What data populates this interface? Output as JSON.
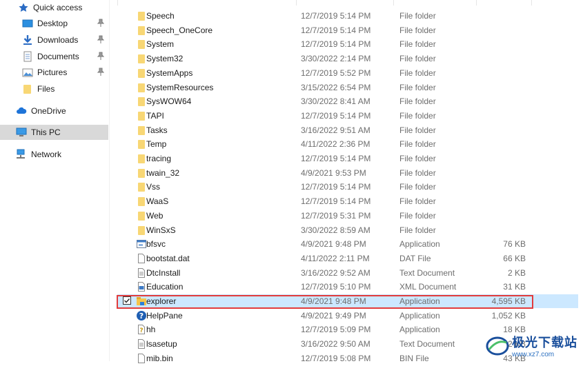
{
  "nav": {
    "quick_access": "Quick access",
    "items": [
      {
        "label": "Desktop",
        "icon": "desktop-icon",
        "pinned": true
      },
      {
        "label": "Downloads",
        "icon": "download-arrow-icon",
        "pinned": true
      },
      {
        "label": "Documents",
        "icon": "documents-icon",
        "pinned": true
      },
      {
        "label": "Pictures",
        "icon": "pictures-icon",
        "pinned": true
      },
      {
        "label": "Files",
        "icon": "folder-icon",
        "pinned": false
      }
    ],
    "onedrive": "OneDrive",
    "this_pc": "This PC",
    "network": "Network"
  },
  "files": [
    {
      "name": "Speech",
      "date": "12/7/2019 5:14 PM",
      "type": "File folder",
      "size": "",
      "icon": "folder-icon"
    },
    {
      "name": "Speech_OneCore",
      "date": "12/7/2019 5:14 PM",
      "type": "File folder",
      "size": "",
      "icon": "folder-icon"
    },
    {
      "name": "System",
      "date": "12/7/2019 5:14 PM",
      "type": "File folder",
      "size": "",
      "icon": "folder-icon"
    },
    {
      "name": "System32",
      "date": "3/30/2022 2:14 PM",
      "type": "File folder",
      "size": "",
      "icon": "folder-icon"
    },
    {
      "name": "SystemApps",
      "date": "12/7/2019 5:52 PM",
      "type": "File folder",
      "size": "",
      "icon": "folder-icon"
    },
    {
      "name": "SystemResources",
      "date": "3/15/2022 6:54 PM",
      "type": "File folder",
      "size": "",
      "icon": "folder-icon"
    },
    {
      "name": "SysWOW64",
      "date": "3/30/2022 8:41 AM",
      "type": "File folder",
      "size": "",
      "icon": "folder-icon"
    },
    {
      "name": "TAPI",
      "date": "12/7/2019 5:14 PM",
      "type": "File folder",
      "size": "",
      "icon": "folder-icon"
    },
    {
      "name": "Tasks",
      "date": "3/16/2022 9:51 AM",
      "type": "File folder",
      "size": "",
      "icon": "folder-icon"
    },
    {
      "name": "Temp",
      "date": "4/11/2022 2:36 PM",
      "type": "File folder",
      "size": "",
      "icon": "folder-icon"
    },
    {
      "name": "tracing",
      "date": "12/7/2019 5:14 PM",
      "type": "File folder",
      "size": "",
      "icon": "folder-icon"
    },
    {
      "name": "twain_32",
      "date": "4/9/2021 9:53 PM",
      "type": "File folder",
      "size": "",
      "icon": "folder-icon"
    },
    {
      "name": "Vss",
      "date": "12/7/2019 5:14 PM",
      "type": "File folder",
      "size": "",
      "icon": "folder-icon"
    },
    {
      "name": "WaaS",
      "date": "12/7/2019 5:14 PM",
      "type": "File folder",
      "size": "",
      "icon": "folder-icon"
    },
    {
      "name": "Web",
      "date": "12/7/2019 5:31 PM",
      "type": "File folder",
      "size": "",
      "icon": "folder-icon"
    },
    {
      "name": "WinSxS",
      "date": "3/30/2022 8:59 AM",
      "type": "File folder",
      "size": "",
      "icon": "folder-icon"
    },
    {
      "name": "bfsvc",
      "date": "4/9/2021 9:48 PM",
      "type": "Application",
      "size": "76 KB",
      "icon": "application-icon"
    },
    {
      "name": "bootstat.dat",
      "date": "4/11/2022 2:11 PM",
      "type": "DAT File",
      "size": "66 KB",
      "icon": "file-icon"
    },
    {
      "name": "DtcInstall",
      "date": "3/16/2022 9:52 AM",
      "type": "Text Document",
      "size": "2 KB",
      "icon": "text-file-icon"
    },
    {
      "name": "Education",
      "date": "12/7/2019 5:10 PM",
      "type": "XML Document",
      "size": "31 KB",
      "icon": "xml-file-icon"
    },
    {
      "name": "explorer",
      "date": "4/9/2021 9:48 PM",
      "type": "Application",
      "size": "4,595 KB",
      "icon": "explorer-app-icon",
      "selected": true
    },
    {
      "name": "HelpPane",
      "date": "4/9/2021 9:49 PM",
      "type": "Application",
      "size": "1,052 KB",
      "icon": "help-icon"
    },
    {
      "name": "hh",
      "date": "12/7/2019 5:09 PM",
      "type": "Application",
      "size": "18 KB",
      "icon": "help-file-icon"
    },
    {
      "name": "lsasetup",
      "date": "3/16/2022 9:50 AM",
      "type": "Text Document",
      "size": "2 KB",
      "icon": "text-file-icon"
    },
    {
      "name": "mib.bin",
      "date": "12/7/2019 5:08 PM",
      "type": "BIN File",
      "size": "43 KB",
      "icon": "file-icon"
    }
  ],
  "watermark": {
    "cn": "极光下载站",
    "url": "www.xz7.com"
  },
  "colors": {
    "selection": "#cce8ff",
    "highlight": "#e23b3b",
    "folder": "#f8d775",
    "nav_selected": "#d9d9d9"
  }
}
